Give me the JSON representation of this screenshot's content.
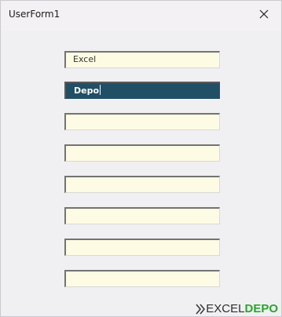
{
  "window": {
    "title": "UserForm1",
    "close_icon": "close-icon"
  },
  "fields": [
    {
      "value": "Excel",
      "active": false
    },
    {
      "value": "Depo",
      "active": true
    },
    {
      "value": "",
      "active": false
    },
    {
      "value": "",
      "active": false
    },
    {
      "value": "",
      "active": false
    },
    {
      "value": "",
      "active": false
    },
    {
      "value": "",
      "active": false
    },
    {
      "value": "",
      "active": false
    }
  ],
  "watermark": {
    "part1": "EXCEL",
    "part2": "DEPO",
    "color1": "#2e2e2e",
    "color2": "#2aa52a"
  },
  "colors": {
    "field_bg": "#fdfbe3",
    "field_active_bg": "#214f66"
  }
}
